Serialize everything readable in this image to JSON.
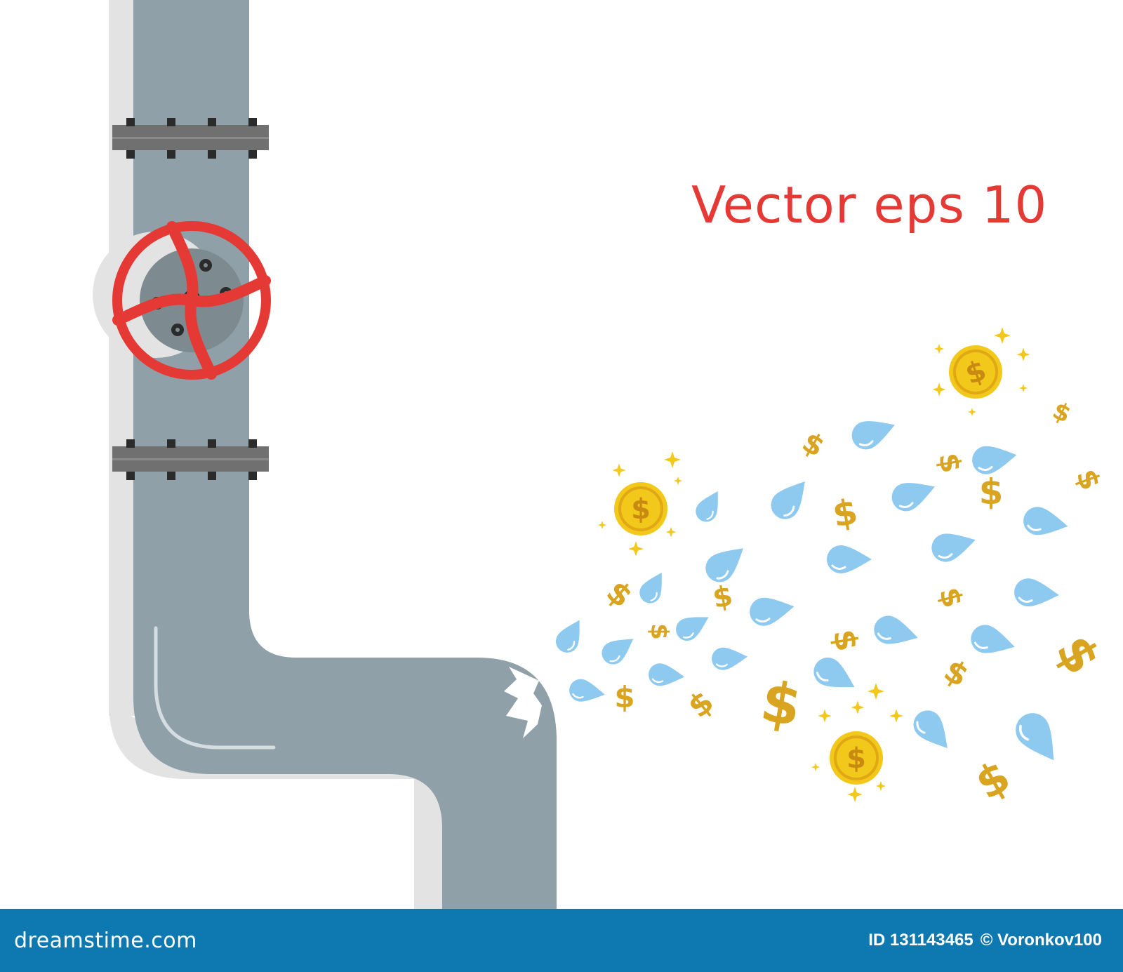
{
  "caption": "Vector eps 10",
  "footer": {
    "brand": "dreamstime.com",
    "image_id": "ID 131143465",
    "copyright": "© Voronkov100"
  },
  "coin_glyph": "$",
  "icons": [
    "pipe",
    "valve-wheel",
    "crack",
    "water-drop",
    "gold-coin",
    "dollar-sign",
    "sparkle"
  ],
  "colors": {
    "pipe": "#8fa0a8",
    "pipe_shadow": "#e3e3e3",
    "valve": "#e53935",
    "water": "#8ec9f0",
    "gold": "#e7b92b",
    "caption": "#e53935",
    "footer": "#0e78b0"
  }
}
